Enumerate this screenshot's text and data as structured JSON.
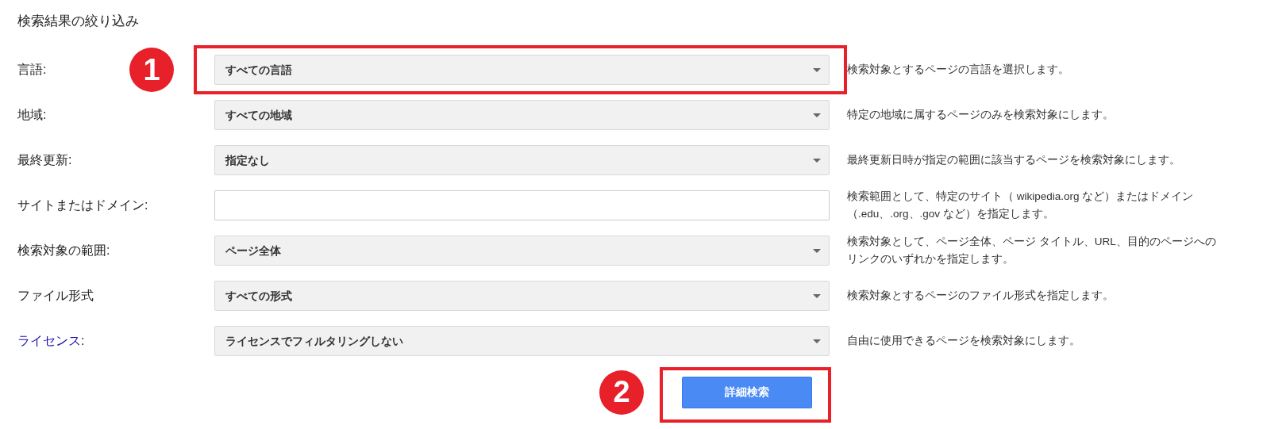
{
  "title": "検索結果の絞り込み",
  "rows": [
    {
      "label": "言語:",
      "link": false,
      "kind": "select",
      "value": "すべての言語",
      "hint": "検索対象とするページの言語を選択します。",
      "callout": "1"
    },
    {
      "label": "地域:",
      "link": false,
      "kind": "select",
      "value": "すべての地域",
      "hint": "特定の地域に属するページのみを検索対象にします。"
    },
    {
      "label": "最終更新:",
      "link": false,
      "kind": "select",
      "value": "指定なし",
      "hint": "最終更新日時が指定の範囲に該当するページを検索対象にします。"
    },
    {
      "label": "サイトまたはドメイン:",
      "link": false,
      "kind": "text",
      "hint": "検索範囲として、特定のサイト（ wikipedia.org など）またはドメイン（.edu、.org、.gov など）を指定します。"
    },
    {
      "label": "検索対象の範囲:",
      "link": false,
      "kind": "select",
      "value": "ページ全体",
      "hint": "検索対象として、ページ全体、ページ タイトル、URL、目的のページへのリンクのいずれかを指定します。"
    },
    {
      "label": "ファイル形式",
      "link": false,
      "kind": "select",
      "value": "すべての形式",
      "hint": "検索対象とするページのファイル形式を指定します。"
    },
    {
      "label": "ライセンス",
      "link": true,
      "suffix": ":",
      "kind": "select",
      "value": "ライセンスでフィルタリングしない",
      "hint": "自由に使用できるページを検索対象にします。"
    }
  ],
  "button": {
    "label": "詳細検索",
    "callout": "2"
  }
}
